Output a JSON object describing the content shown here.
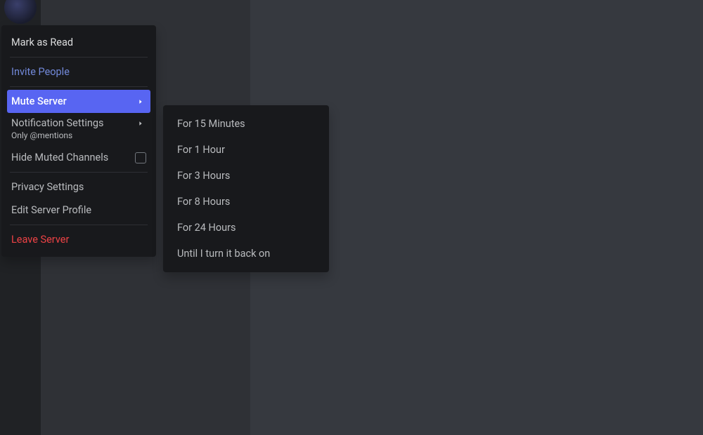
{
  "menu": {
    "mark_read": "Mark as Read",
    "invite": "Invite People",
    "mute_server": "Mute Server",
    "notification_settings": "Notification Settings",
    "notification_sub": "Only @mentions",
    "hide_muted": "Hide Muted Channels",
    "privacy": "Privacy Settings",
    "edit_profile": "Edit Server Profile",
    "leave": "Leave Server"
  },
  "submenu": {
    "items": [
      "For 15 Minutes",
      "For 1 Hour",
      "For 3 Hours",
      "For 8 Hours",
      "For 24 Hours",
      "Until I turn it back on"
    ]
  },
  "colors": {
    "accent": "#5865f2",
    "link": "#7289da",
    "danger": "#ed4245",
    "bg_dark": "#18191c",
    "bg_channel": "#2f3136",
    "bg_main": "#36393f",
    "bg_rail": "#202225"
  }
}
